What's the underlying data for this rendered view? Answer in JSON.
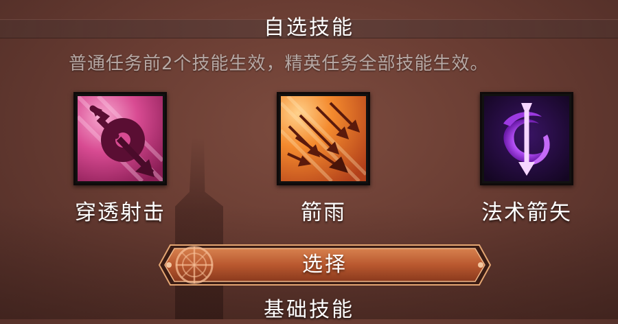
{
  "header": {
    "title": "自选技能",
    "description": "普通任务前2个技能生效，精英任务全部技能生效。"
  },
  "skills": [
    {
      "label": "穿透射击",
      "icon": "piercing-shot-icon",
      "color": "#d1478f"
    },
    {
      "label": "箭雨",
      "icon": "arrow-rain-icon",
      "color": "#f07a2a"
    },
    {
      "label": "法术箭矢",
      "icon": "arcane-arrow-icon",
      "color": "#a64bf0"
    }
  ],
  "select_button": {
    "label": "选择",
    "accent": "#c96a3c"
  },
  "next_section": {
    "title": "基础技能"
  }
}
